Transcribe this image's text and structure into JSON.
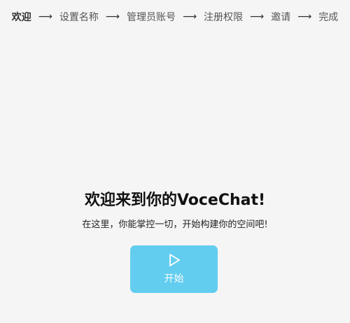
{
  "steps": [
    {
      "label": "欢迎",
      "active": true
    },
    {
      "label": "设置名称",
      "active": false
    },
    {
      "label": "管理员账号",
      "active": false
    },
    {
      "label": "注册权限",
      "active": false
    },
    {
      "label": "邀请",
      "active": false
    },
    {
      "label": "完成",
      "active": false
    }
  ],
  "step_arrow": "⟶",
  "main": {
    "title": "欢迎来到你的VoceChat!",
    "subtitle": "在这里，你能掌控一切，开始构建你的空间吧!",
    "start_button_label": "开始",
    "start_button_icon": "play-icon"
  },
  "colors": {
    "background": "#f5f5f5",
    "button": "#62cdef",
    "button_text": "#ffffff"
  }
}
